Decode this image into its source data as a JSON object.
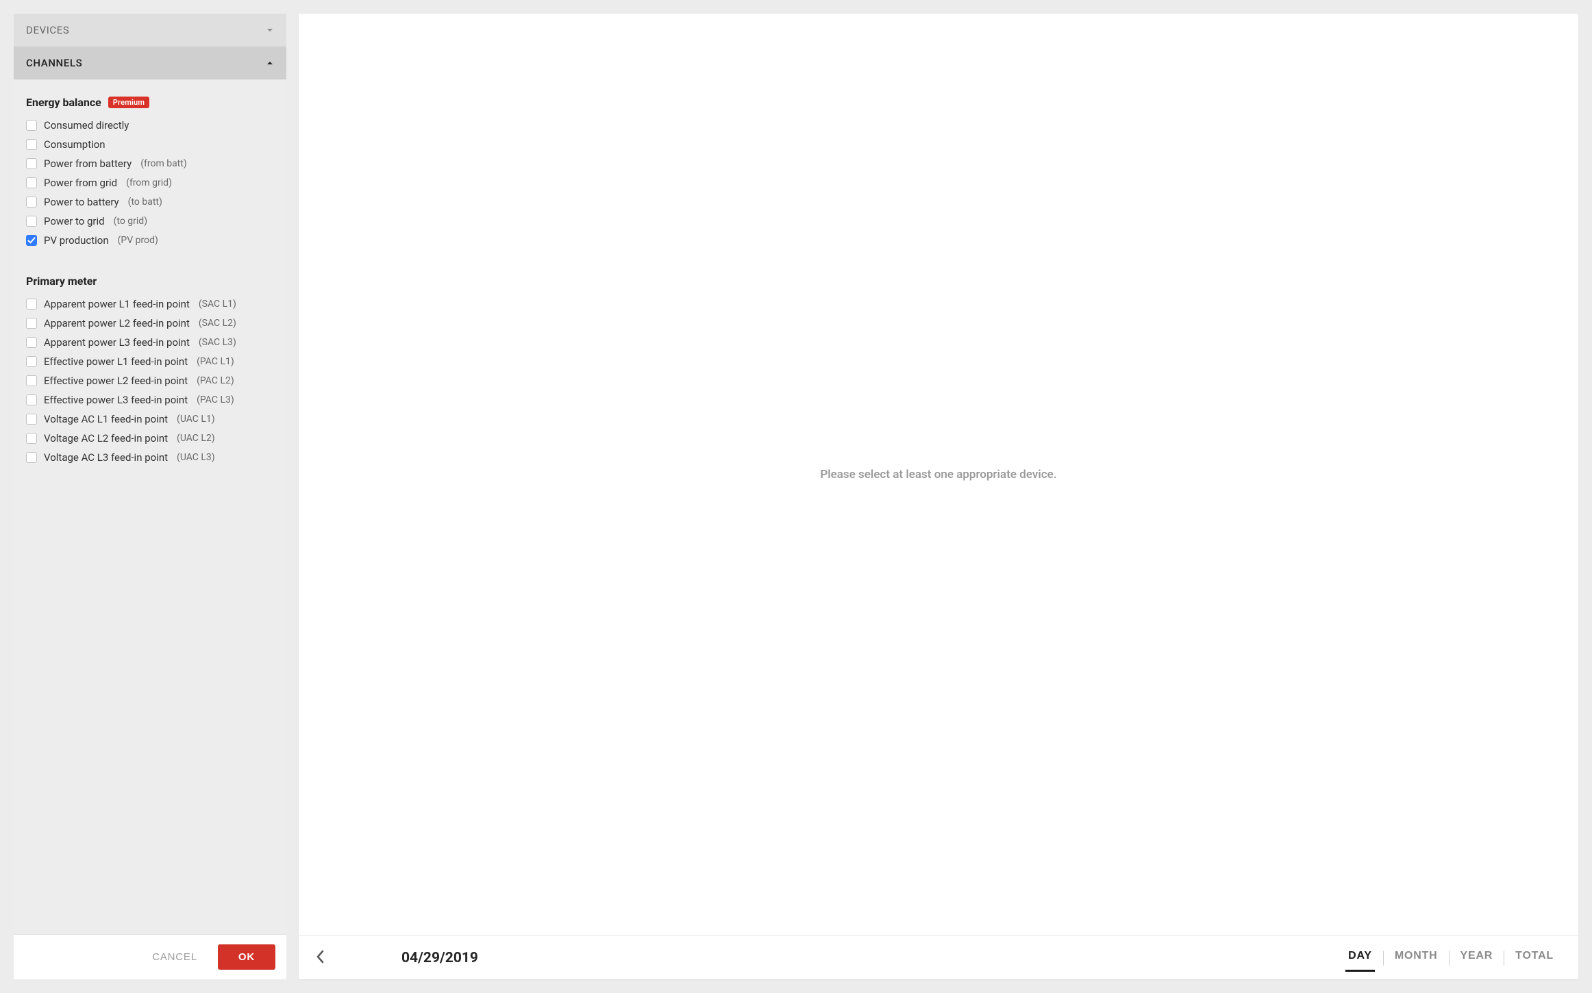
{
  "sidebar": {
    "devices_label": "DEVICES",
    "channels_label": "CHANNELS",
    "groups": [
      {
        "title": "Energy balance",
        "badge": "Premium",
        "items": [
          {
            "label": "Consumed directly",
            "suffix": "",
            "checked": false
          },
          {
            "label": "Consumption",
            "suffix": "",
            "checked": false
          },
          {
            "label": "Power from battery",
            "suffix": "(from batt)",
            "checked": false
          },
          {
            "label": "Power from grid",
            "suffix": "(from grid)",
            "checked": false
          },
          {
            "label": "Power to battery",
            "suffix": "(to batt)",
            "checked": false
          },
          {
            "label": "Power to grid",
            "suffix": "(to grid)",
            "checked": false
          },
          {
            "label": "PV production",
            "suffix": "(PV prod)",
            "checked": true
          }
        ]
      },
      {
        "title": "Primary meter",
        "badge": "",
        "items": [
          {
            "label": "Apparent power L1 feed-in point",
            "suffix": "(SAC L1)",
            "checked": false
          },
          {
            "label": "Apparent power L2 feed-in point",
            "suffix": "(SAC L2)",
            "checked": false
          },
          {
            "label": "Apparent power L3 feed-in point",
            "suffix": "(SAC L3)",
            "checked": false
          },
          {
            "label": "Effective power L1 feed-in point",
            "suffix": "(PAC L1)",
            "checked": false
          },
          {
            "label": "Effective power L2 feed-in point",
            "suffix": "(PAC L2)",
            "checked": false
          },
          {
            "label": "Effective power L3 feed-in point",
            "suffix": "(PAC L3)",
            "checked": false
          },
          {
            "label": "Voltage AC L1 feed-in point",
            "suffix": "(UAC L1)",
            "checked": false
          },
          {
            "label": "Voltage AC L2 feed-in point",
            "suffix": "(UAC L2)",
            "checked": false
          },
          {
            "label": "Voltage AC L3 feed-in point",
            "suffix": "(UAC L3)",
            "checked": false
          }
        ]
      }
    ],
    "cancel_label": "CANCEL",
    "ok_label": "OK"
  },
  "main": {
    "empty_message": "Please select at least one appropriate device.",
    "date": "04/29/2019",
    "range_tabs": [
      {
        "label": "DAY",
        "active": true
      },
      {
        "label": "MONTH",
        "active": false
      },
      {
        "label": "YEAR",
        "active": false
      },
      {
        "label": "TOTAL",
        "active": false
      }
    ]
  }
}
